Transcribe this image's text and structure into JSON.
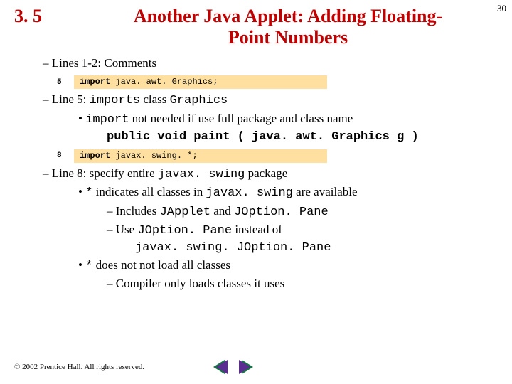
{
  "page_number": "30",
  "section_number": "3. 5",
  "title_line1": "Another Java Applet: Adding Floating-",
  "title_line2": "Point Numbers",
  "bullets": {
    "l1a": "– Lines 1-2: Comments",
    "l5_pre": "– Line 5: ",
    "l5_code1": "imports",
    "l5_mid": " class ",
    "l5_code2": "Graphics",
    "l5_sub_pre": "• ",
    "l5_sub_code": "import",
    "l5_sub_post": " not needed if use full package and class name",
    "pubdecl": "public void paint ( java. awt. Graphics g )",
    "l8_pre": "– Line 8: specify entire ",
    "l8_code": "javax. swing",
    "l8_post": " package",
    "star1_pre": "• ",
    "star1_code1": "*",
    "star1_mid": " indicates all classes in ",
    "star1_code2": "javax. swing",
    "star1_post": " are available",
    "inc_pre": "– Includes ",
    "inc_code1": "JApplet",
    "inc_mid": " and ",
    "inc_code2": "JOption. Pane",
    "use_pre": "– Use ",
    "use_code": "JOption. Pane",
    "use_post": " instead of",
    "use_full": "javax. swing. JOption. Pane",
    "star2_pre": "• ",
    "star2_code": "*",
    "star2_post": " does not not load all classes",
    "compiler": "– Compiler only loads classes it uses"
  },
  "code1": {
    "ln": "5",
    "kw": "import",
    "rest": " java. awt. Graphics;"
  },
  "code2": {
    "ln": "8",
    "kw": "import",
    "rest": " javax. swing. *;"
  },
  "footer": "© 2002 Prentice Hall. All rights reserved."
}
